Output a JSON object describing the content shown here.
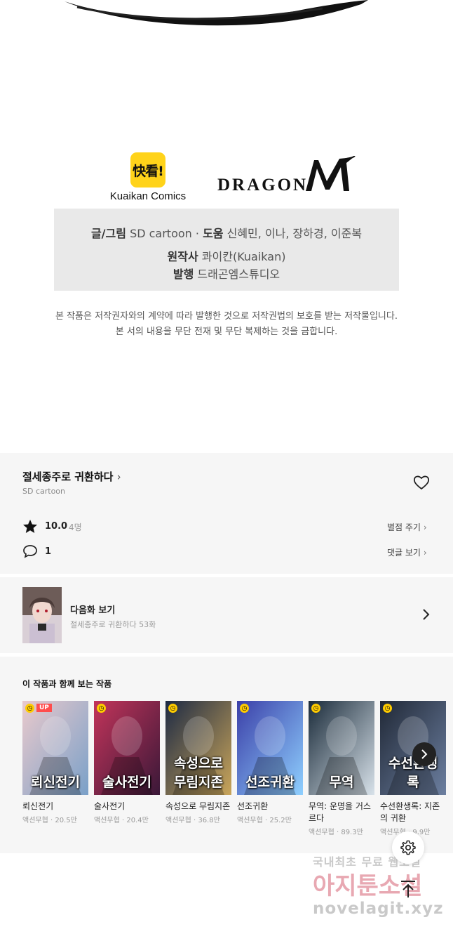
{
  "logos": {
    "kuaikan_mark": "快看!",
    "kuaikan_name": "Kuaikan Comics",
    "dragon_name": "DRAGON",
    "dragon_m": "M"
  },
  "credits": {
    "story_art_label": "글/그림",
    "story_art_value": "SD cartoon",
    "assist_label": "도움",
    "assist_value": "신혜민, 이나, 장하경, 이준복",
    "original_label": "원작사",
    "original_value": "콰이칸(Kuaikan)",
    "publisher_label": "발행",
    "publisher_value": "드래곤엠스튜디오"
  },
  "notice": {
    "line1": "본 작품은 저작권자와의 계약에 따라 발행한 것으로 저작권법의 보호를 받는 저작물입니다.",
    "line2": "본 서의 내용을 무단 전재 및 무단 복제하는 것을 금합니다."
  },
  "info": {
    "title": "절세종주로 귀환하다",
    "author": "SD cartoon",
    "score": "10.0",
    "raters": "4명",
    "rate_link": "별점 주기",
    "comments": "1",
    "comment_link": "댓글 보기"
  },
  "next_episode": {
    "title": "다음화 보기",
    "subtitle": "절세종주로 귀환하다 53화"
  },
  "related": {
    "heading": "이 작품과 함께 보는 작품",
    "items": [
      {
        "title": "뢰신전기",
        "meta": "액션무협 · 20.5만",
        "cover_text": "뢰신전기",
        "badge": "UP",
        "c1": "#e9c9cc",
        "c2": "#7aa0c8"
      },
      {
        "title": "술사전기",
        "meta": "액션무협 · 20.4만",
        "cover_text": "술사전기",
        "badge": "",
        "c1": "#c2345a",
        "c2": "#3a1838"
      },
      {
        "title": "속성으로 무림지존",
        "meta": "액션무협 · 36.8만",
        "cover_text": "속성으로 무림지존",
        "badge": "",
        "c1": "#1d2a44",
        "c2": "#c9a55a"
      },
      {
        "title": "선조귀환",
        "meta": "액션무협 · 25.2만",
        "cover_text": "선조귀환",
        "badge": "",
        "c1": "#3b3fa8",
        "c2": "#8fd0ff"
      },
      {
        "title": "무역: 운명을 거스르다",
        "meta": "액션무협 · 89.3만",
        "cover_text": "무역",
        "badge": "",
        "c1": "#1a2b3a",
        "c2": "#d8e2ea"
      },
      {
        "title": "수선환생록: 지존의 귀환",
        "meta": "액션무협 · 9.9만",
        "cover_text": "수선환생록",
        "badge": "",
        "c1": "#202836",
        "c2": "#6c7fa0"
      }
    ]
  },
  "watermark": {
    "line1": "국내최초 무료 웹소설",
    "line2": "아지툰소설",
    "line3": "novelagit.xyz"
  }
}
